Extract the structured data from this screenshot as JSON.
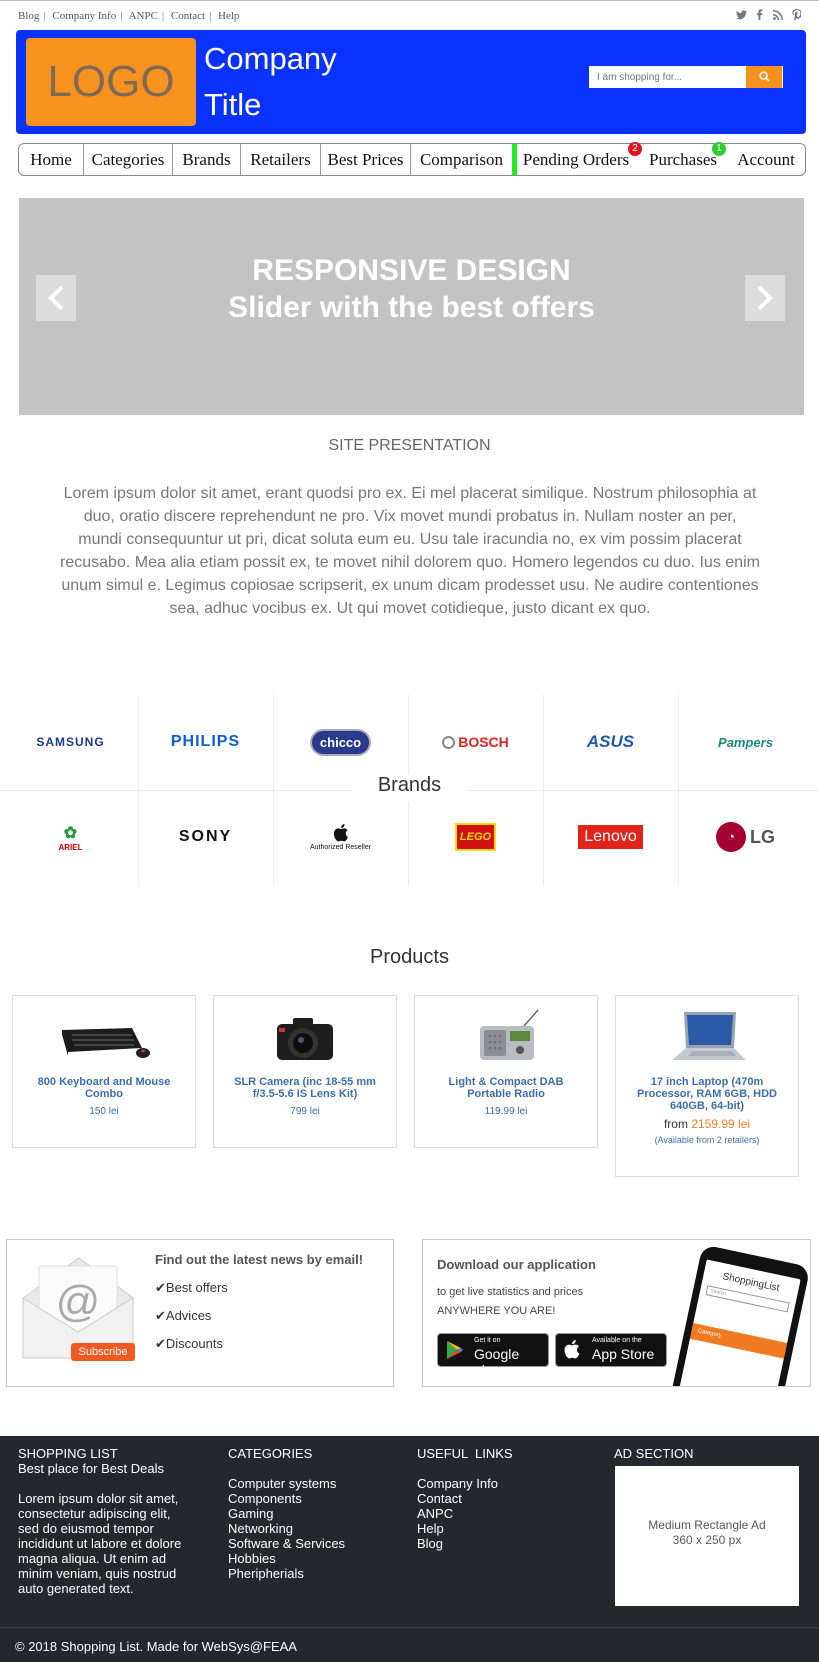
{
  "topbar": {
    "links": [
      "Blog",
      "Company Info",
      "ANPC",
      "Contact",
      "Help"
    ],
    "social_icons": [
      "twitter-icon",
      "facebook-icon",
      "rss-icon",
      "pinterest-icon"
    ]
  },
  "header": {
    "logo": "LOGO",
    "company_line1": "Company",
    "company_line2": "Title",
    "search_placeholder": "I am shopping for...",
    "search_icon": "search-icon"
  },
  "nav": {
    "items": [
      "Home",
      "Categories",
      "Brands",
      "Retailers",
      "Best Prices",
      "Comparison",
      "Pending Orders",
      "Purchases",
      "Account"
    ],
    "pending_badge": "2",
    "purchases_badge": "1",
    "accent_green": "#1dee1d"
  },
  "slider": {
    "line1": "RESPONSIVE DESIGN",
    "line2": "Slider with the best offers",
    "prev": "<",
    "next": ">"
  },
  "presentation": {
    "title": "SITE PRESENTATION",
    "text": "Lorem ipsum dolor sit amet, erant quodsi pro ex. Ei mel placerat similique. Nostrum philosophia at duo, oratio discere reprehendunt ne pro. Vix movet mundi probatus in. Nullam noster an per, mundi consequuntur ut pri, dicat soluta eum eu. Usu tale iracundia no, ex vim possim placerat recusabo. Mea alia etiam possit ex, te movet nihil dolorem quo. Homero legendos cu duo. Ius enim unum simul e. Legimus copiosae scripserit, ex unum dicam prodesset usu. Ne audire contentiones sea, adhuc vocibus ex. Ut qui movet cotidieque, justo dicant ex quo."
  },
  "brands": {
    "label": "Brands",
    "row1": [
      "SAMSUNG",
      "PHILIPS",
      "chicco",
      "BOSCH",
      "ASUS",
      "Pampers"
    ],
    "row2": [
      "ARIEL",
      "SONY",
      "Authorized Reseller",
      "LEGO",
      "Lenovo",
      "LG"
    ]
  },
  "products": {
    "title": "Products",
    "items": [
      {
        "name": "800 Keyboard and Mouse Combo",
        "price": "150 lei"
      },
      {
        "name": "SLR Camera (inc 18-55 mm f/3.5-5.6 IS Lens Kit)",
        "price": "799 lei"
      },
      {
        "name": "Light & Compact DAB Portable Radio",
        "price": "119.99 lei"
      },
      {
        "name": "17 inch Laptop (470m Processor, RAM 6GB, HDD 640GB, 64-bit)",
        "from_label": "from",
        "from_price": "2159.99 lei",
        "availability": "(Available from 2 retailers)"
      }
    ]
  },
  "newsletter": {
    "title": "Find out the latest news by email!",
    "items": [
      "Best offers",
      "Advices",
      "Discounts"
    ],
    "subscribe": "Subscribe"
  },
  "app": {
    "title": "Download our application",
    "line1": "to get live statistics and prices",
    "line2": "ANYWHERE YOU ARE!",
    "google_small": "Get it on",
    "google_big": "Google play",
    "apple_small": "Available on the",
    "apple_big": "App Store",
    "phone_title": "ShoppingList",
    "phone_search": "Search",
    "phone_category": "Category"
  },
  "footer": {
    "col1_head": "SHOPPING LIST",
    "col1_sub": "Best place for Best Deals",
    "col1_text": "Lorem ipsum dolor sit amet, consectetur adipiscing elit, sed do eiusmod tempor incididunt ut labore et dolore magna aliqua. Ut enim ad minim veniam, quis nostrud auto generated text.",
    "col2_head": "CATEGORIES",
    "categories": [
      "Computer systems",
      "Components",
      "Gaming",
      "Networking",
      "Software & Services",
      "Hobbies",
      "Pheripherials"
    ],
    "col3_head": "USEFUL  LINKS",
    "links": [
      "Company Info",
      "Contact",
      "ANPC",
      "Help",
      "Blog"
    ],
    "col4_head": "AD SECTION",
    "ad_line1": "Medium Rectangle Ad",
    "ad_line2": "360 x 250 px",
    "copyright": "© 2018 Shopping List. Made for WebSys@FEAA"
  }
}
